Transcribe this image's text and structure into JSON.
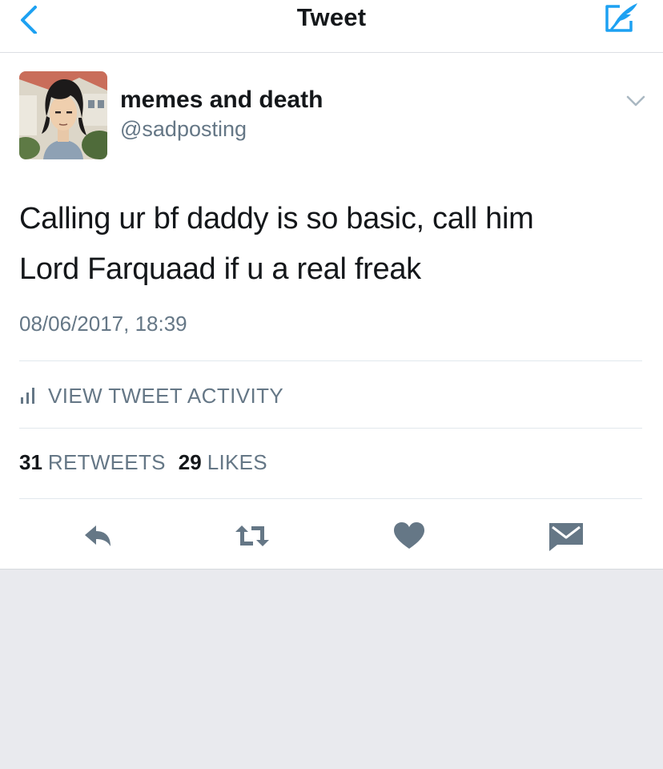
{
  "navbar": {
    "title": "Tweet",
    "back_icon": "chevron-left-icon",
    "compose_icon": "compose-tweet-icon",
    "accent_color": "#1da1f2"
  },
  "tweet": {
    "author": {
      "display_name": "memes and death",
      "handle": "@sadposting",
      "avatar": "avatar-image"
    },
    "text_lines": [
      "Calling ur bf daddy is so basic, call him",
      "Lord Farquaad if u a real freak"
    ],
    "timestamp": "08/06/2017, 18:39",
    "activity_label": "VIEW TWEET ACTIVITY",
    "stats": {
      "retweets_count": "31",
      "retweets_label": "RETWEETS",
      "likes_count": "29",
      "likes_label": "LIKES"
    },
    "actions": [
      {
        "icon": "reply-icon"
      },
      {
        "icon": "retweet-icon"
      },
      {
        "icon": "like-heart-icon"
      },
      {
        "icon": "direct-message-icon"
      }
    ]
  }
}
